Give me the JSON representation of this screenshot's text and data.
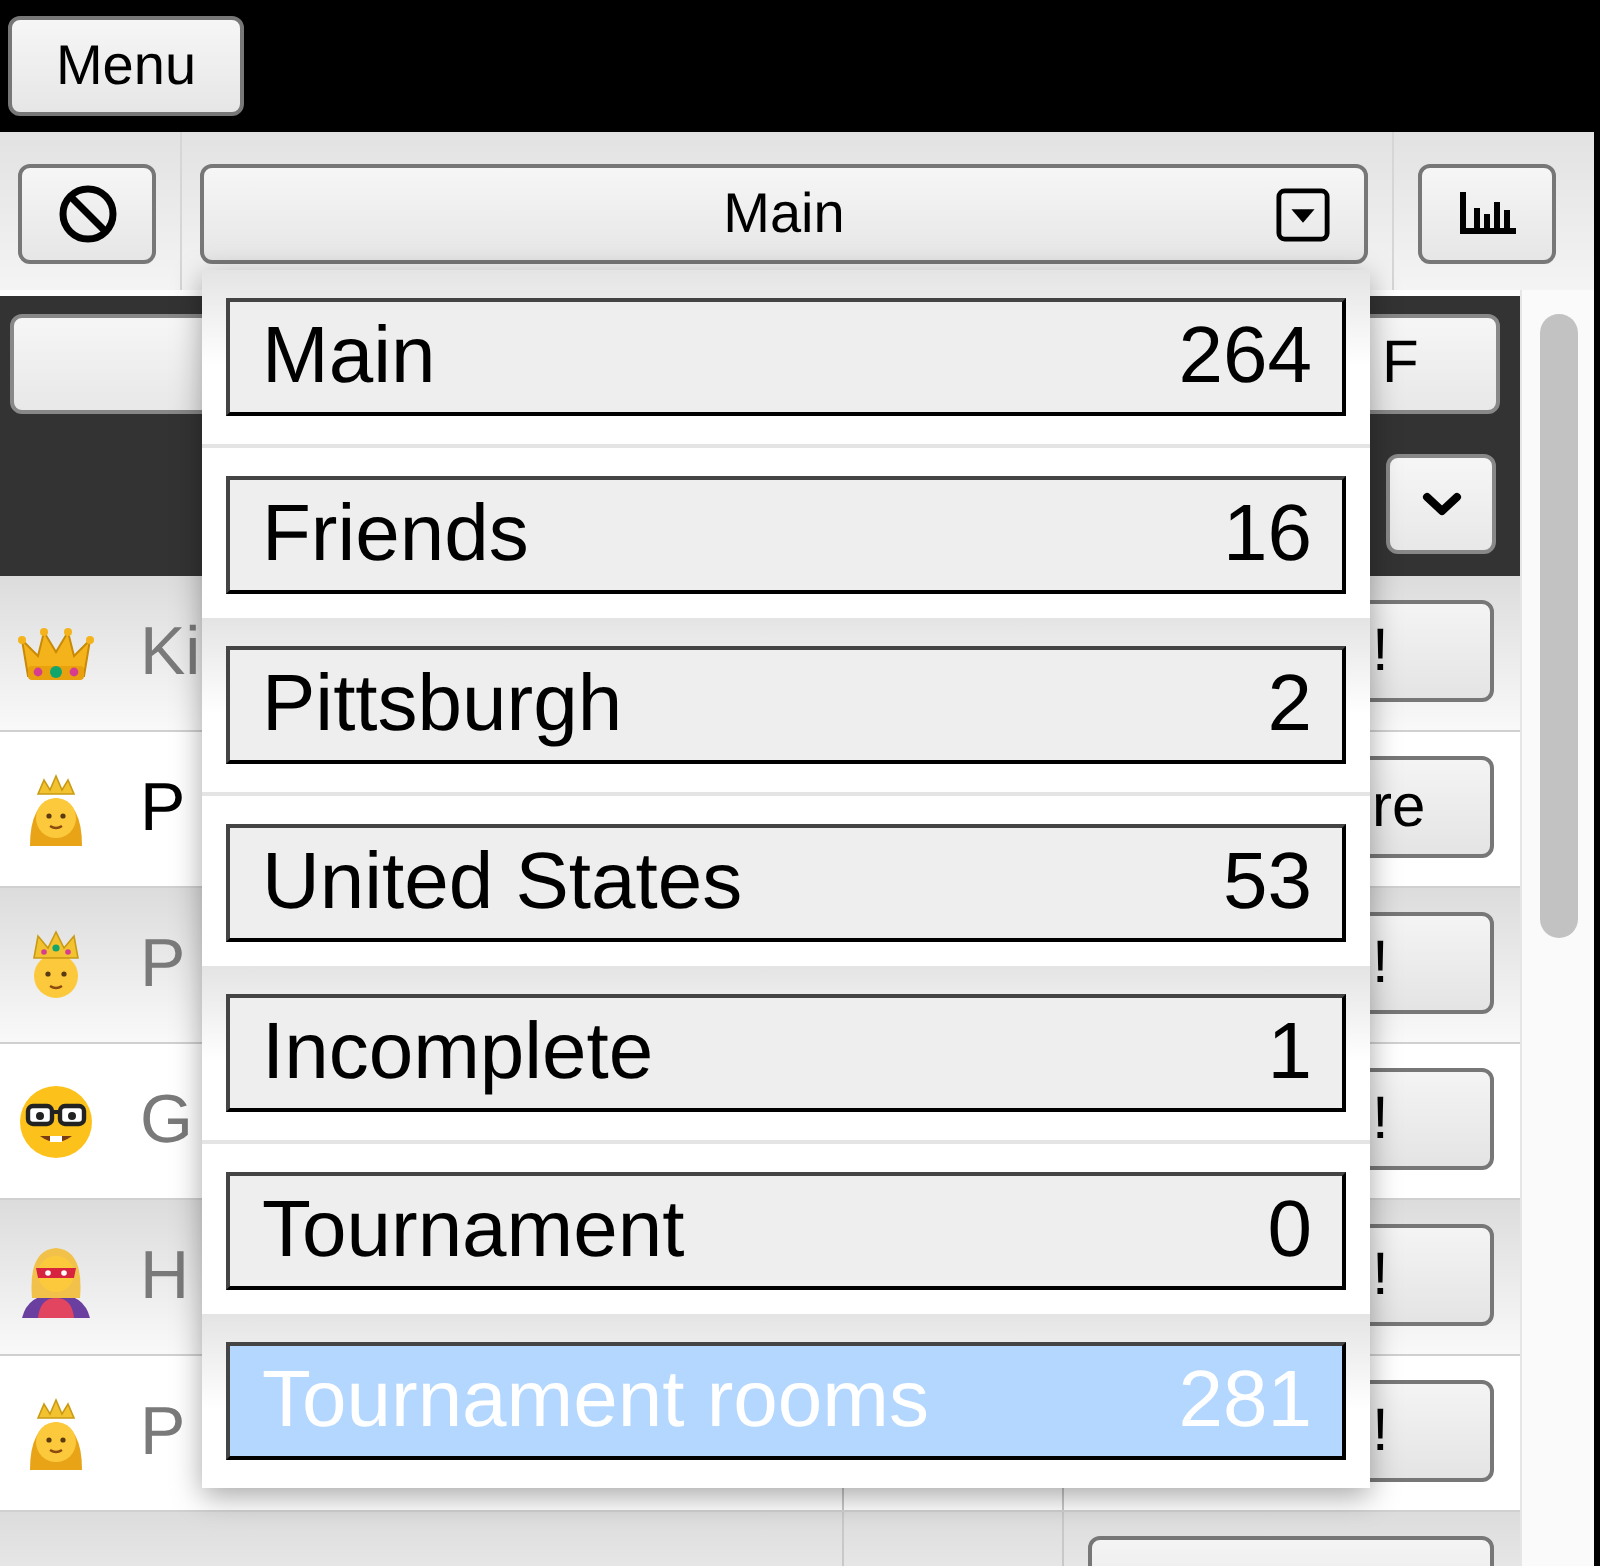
{
  "menu_button": "Menu",
  "toolbar": {
    "list_select": {
      "value": "Main"
    }
  },
  "header": {
    "filter_button": "F"
  },
  "rows": [
    {
      "kind": "crown",
      "name": "Ki",
      "active": false,
      "action": "!"
    },
    {
      "kind": "princess",
      "name": "P",
      "active": true,
      "action": "re"
    },
    {
      "kind": "prince",
      "name": "P",
      "active": false,
      "action": "!"
    },
    {
      "kind": "nerd",
      "name": "G",
      "active": false,
      "action": "!"
    },
    {
      "kind": "superhero",
      "name": "H",
      "active": false,
      "action": "!"
    },
    {
      "kind": "princess",
      "name": "P",
      "active": false,
      "action": "!"
    },
    {
      "kind": "none"
    }
  ],
  "dropdown": {
    "items": [
      {
        "label": "Main",
        "count": "264",
        "selected": false
      },
      {
        "label": "Friends",
        "count": "16",
        "selected": false
      },
      {
        "label": "Pittsburgh",
        "count": "2",
        "selected": false
      },
      {
        "label": "United States",
        "count": "53",
        "selected": false
      },
      {
        "label": "Incomplete",
        "count": "1",
        "selected": false
      },
      {
        "label": "Tournament",
        "count": "0",
        "selected": false
      },
      {
        "label": "Tournament rooms",
        "count": "281",
        "selected": true
      }
    ]
  }
}
